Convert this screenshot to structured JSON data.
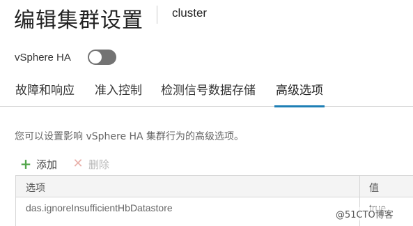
{
  "header": {
    "title": "编辑集群设置",
    "cluster_name": "cluster"
  },
  "ha": {
    "label": "vSphere HA",
    "enabled": false
  },
  "tabs": [
    {
      "label": "故障和响应",
      "active": false
    },
    {
      "label": "准入控制",
      "active": false
    },
    {
      "label": "检测信号数据存储",
      "active": false
    },
    {
      "label": "高级选项",
      "active": true
    }
  ],
  "description": "您可以设置影响 vSphere HA 集群行为的高级选项。",
  "toolbar": {
    "add_label": "添加",
    "delete_label": "删除"
  },
  "grid": {
    "columns": [
      "选项",
      "值"
    ],
    "rows": [
      {
        "option": "das.ignoreInsufficientHbDatastore",
        "value": "true"
      }
    ]
  },
  "watermark": "@51CTO博客",
  "colors": {
    "accent": "#1e7fb5",
    "toggle_off": "#737373",
    "add_icon": "#53a64b"
  }
}
